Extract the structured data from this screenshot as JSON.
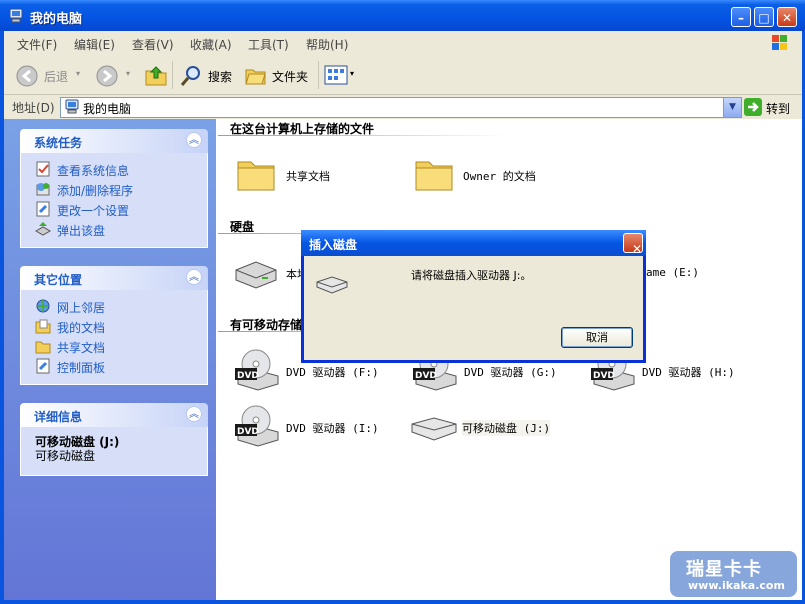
{
  "window": {
    "title": "我的电脑",
    "controls": [
      "minimize-icon",
      "maximize-icon",
      "close-icon"
    ]
  },
  "menubar": {
    "items": [
      "文件(F)",
      "编辑(E)",
      "查看(V)",
      "收藏(A)",
      "工具(T)",
      "帮助(H)"
    ]
  },
  "toolbar": {
    "back_label": "后退",
    "search_label": "搜索",
    "folders_label": "文件夹"
  },
  "address": {
    "label": "地址(D)",
    "value": "我的电脑",
    "go_label": "转到"
  },
  "sidebar": {
    "panels": [
      {
        "title": "系统任务",
        "items": [
          "查看系统信息",
          "添加/删除程序",
          "更改一个设置",
          "弹出该盘"
        ]
      },
      {
        "title": "其它位置",
        "items": [
          "网上邻居",
          "我的文档",
          "共享文档",
          "控制面板"
        ]
      },
      {
        "title": "详细信息",
        "detail_name": "可移动磁盘 (J:)",
        "detail_type": "可移动磁盘"
      }
    ]
  },
  "main": {
    "sections": {
      "stored_files": "在这台计算机上存储的文件",
      "hard_disks": "硬盘",
      "removable": "有可移动存储"
    },
    "files": [
      "共享文档",
      "Owner 的文档"
    ],
    "hard_disks": [
      "本地",
      "ame (E:)"
    ],
    "removable_devices": [
      "DVD 驱动器 (F:)",
      "DVD 驱动器 (G:)",
      "DVD 驱动器 (H:)",
      "DVD 驱动器 (I:)",
      "可移动磁盘 (J:)"
    ]
  },
  "dialog": {
    "title": "插入磁盘",
    "message": "请将磁盘插入驱动器 J:。",
    "cancel_label": "取消"
  },
  "watermark": {
    "line1": "瑞星卡卡",
    "line2": "www.ikaka.com"
  },
  "colors": {
    "title_blue": "#0554e3",
    "sidebar_blue": "#6f8fe0",
    "panel_bg": "#d6dff7",
    "link_blue": "#215dc6",
    "chrome_beige": "#ece9d8"
  }
}
